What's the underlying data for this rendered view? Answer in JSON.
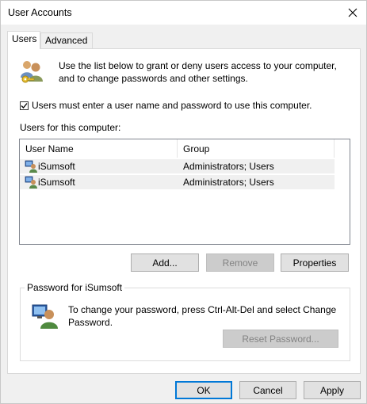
{
  "window": {
    "title": "User Accounts"
  },
  "tabs": [
    {
      "label": "Users",
      "active": true
    },
    {
      "label": "Advanced",
      "active": false
    }
  ],
  "intro": {
    "text_line1": "Use the list below to grant or deny users access to your computer,",
    "text_line2": "and to change passwords and other settings.",
    "icon": "users-keys-icon"
  },
  "require_login": {
    "label": "Users must enter a user name and password to use this computer.",
    "checked": true
  },
  "users_list": {
    "label": "Users for this computer:",
    "columns": [
      "User Name",
      "Group"
    ],
    "rows": [
      {
        "name": "iSumsoft",
        "group": "Administrators; Users"
      },
      {
        "name": "iSumsoft",
        "group": "Administrators; Users"
      }
    ]
  },
  "list_buttons": {
    "add": "Add...",
    "remove": "Remove",
    "properties": "Properties"
  },
  "password_box": {
    "title": "Password for iSumsoft",
    "text_line1": "To change your password, press Ctrl-Alt-Del and select Change",
    "text_line2": "Password.",
    "reset_label": "Reset Password..."
  },
  "dialog_buttons": {
    "ok": "OK",
    "cancel": "Cancel",
    "apply": "Apply"
  },
  "colors": {
    "accent": "#0078d7",
    "row_bg": "#f0f0f0",
    "disabled_text": "#838383"
  }
}
